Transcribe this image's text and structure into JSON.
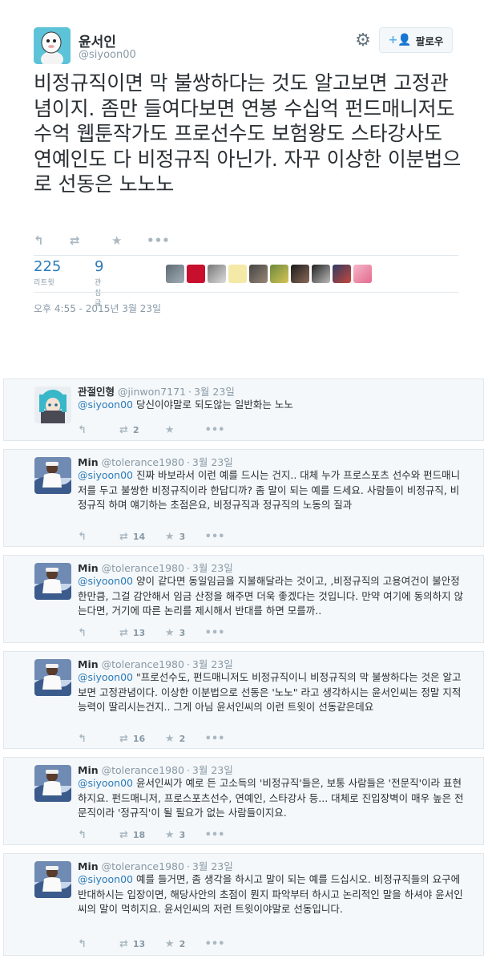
{
  "main_tweet": {
    "author_name": "윤서인",
    "author_handle": "@siyoon00",
    "follow_label": "팔로우",
    "text": "비정규직이면 막 불쌍하다는 것도 알고보면 고정관념이지. 좀만 들여다보면 연봉 수십억 펀드매니저도 수억 웹툰작가도 프로선수도 보험왕도 스타강사도 연예인도 다 비정규직 아닌가. 자꾸 이상한 이분법으로 선동은 노노노",
    "retweets": {
      "count": "225",
      "label": "리트윗"
    },
    "likes": {
      "count": "9",
      "label": "관심글"
    },
    "timestamp": "오후 4:55 - 2015년 3월 23일",
    "icons": {
      "reply": "reply-icon",
      "retweet": "retweet-icon",
      "favorite": "star-icon",
      "more": "more-icon",
      "settings": "gear-icon",
      "follow": "add-user-icon"
    },
    "colors": {
      "accent": "#55acee",
      "link": "#2b7bb9",
      "muted": "#8899a6"
    }
  },
  "replies": [
    {
      "name": "관절인형",
      "handle": "@jinwon7171",
      "time": "3월 23일",
      "mention": "@siyoon00",
      "text": " 당신이야말로 되도않는 일반화는 노노",
      "retweets": "2",
      "favorites": ""
    },
    {
      "name": "Min",
      "handle": "@tolerance1980",
      "time": "3월 23일",
      "mention": "@siyoon00",
      "text": " 진짜 바보라서 이런 예를 드시는 건지.. 대체 누가 프로스포츠 선수와 펀드매니저를 두고 불쌍한 비정규직이라 한답디까? 좀 말이 되는 예를 드세요. 사람들이 비정규직, 비정규직 하며 얘기하는 초점은요, 비정규직과 정규직의 노동의 질과",
      "retweets": "14",
      "favorites": "3"
    },
    {
      "name": "Min",
      "handle": "@tolerance1980",
      "time": "3월 23일",
      "mention": "@siyoon00",
      "text": " 양이 같다면 동일임금을 지불해달라는 것이고, ,비정규직의 고용여건이 불안정한만큼, 그걸 감안해서 임금 산정을 해주면 더욱 좋겠다는 것입니다. 만약 여기에 동의하지 않는다면, 거기에 따른 논리를 제시해서 반대를 하면 모를까..",
      "retweets": "13",
      "favorites": "3"
    },
    {
      "name": "Min",
      "handle": "@tolerance1980",
      "time": "3월 23일",
      "mention": "@siyoon00",
      "text": " \"프로선수도, 펀드매니저도 비정규직이니 비정규직의 막 불쌍하다는 것은 알고보면 고정관념이다. 이상한 이분법으로 선동은 '노노\" 라고 생각하시는 윤서인씨는 정말 지적능력이 딸리시는건지.. 그게 아님 윤서인씨의 이런 트윗이 선동같은데요",
      "retweets": "16",
      "favorites": "2"
    },
    {
      "name": "Min",
      "handle": "@tolerance1980",
      "time": "3월 23일",
      "mention": "@siyoon00",
      "text": " 윤서인씨가 예로 든 고소득의 '비정규직'들은, 보통 사람들은 '전문직'이라 표현하지요. 펀드매니저, 프로스포츠선수, 연예인, 스타강사 등... 대체로 진입장벽이 매우 높은 전문직이라 '정규직'이 될 필요가 없는 사람들이지요.",
      "retweets": "18",
      "favorites": "3"
    },
    {
      "name": "Min",
      "handle": "@tolerance1980",
      "time": "3월 23일",
      "mention": "@siyoon00",
      "text": " 예를 들거면, 좀 생각을 하시고 말이 되는 예를 드십시오. 비정규직들의 요구에 반대하시는 입장이면, 해당사안의 초점이 뭔지 파악부터 하시고 논리적인 말을 하셔야 윤서인씨의 말이 먹히지요. 윤서인씨의 저런 트윗이야말로 선동입니다.",
      "retweets": "13",
      "favorites": "2"
    }
  ]
}
